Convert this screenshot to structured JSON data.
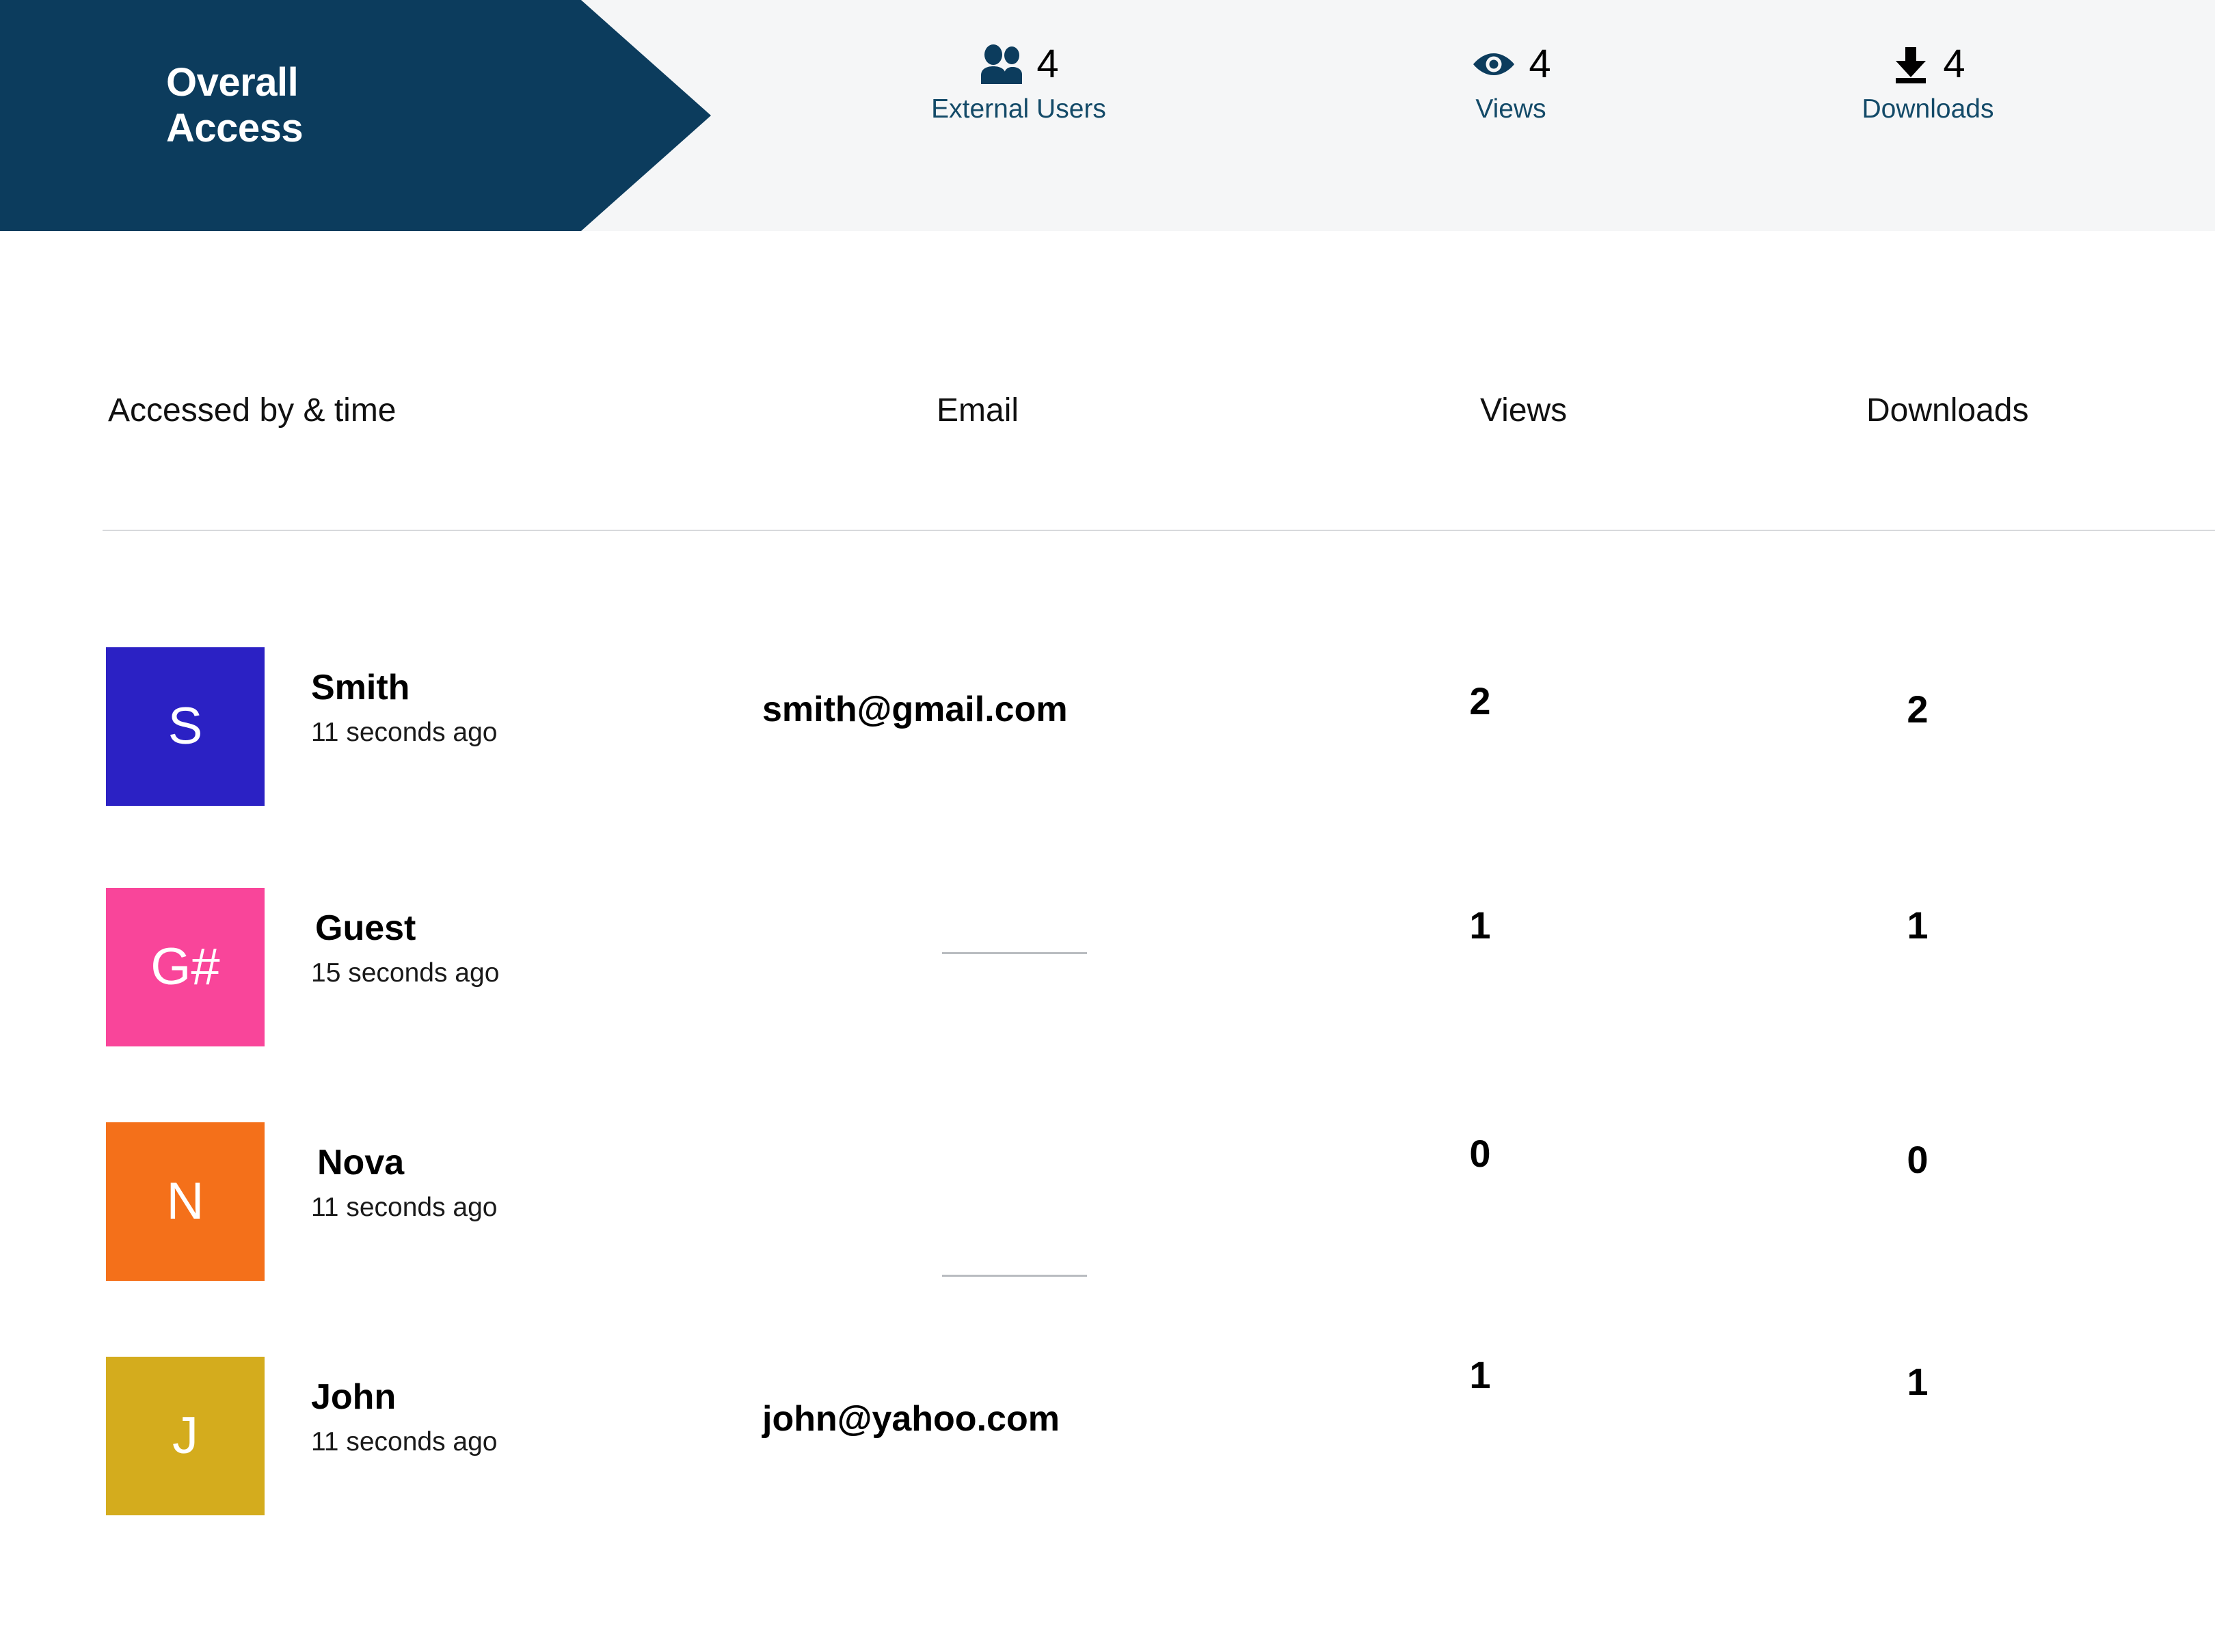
{
  "banner": {
    "title": "Overall\nAccess",
    "color": "#0c3c5d"
  },
  "summary_stats": [
    {
      "icon": "users-icon",
      "value": "4",
      "label": "External Users",
      "icon_color": "#0c3c5d",
      "label_color": "#134a68"
    },
    {
      "icon": "eye-icon",
      "value": "4",
      "label": "Views",
      "icon_color": "#0c3c5d",
      "label_color": "#134a68"
    },
    {
      "icon": "download-icon",
      "value": "4",
      "label": "Downloads",
      "icon_color": "#000000",
      "label_color": "#134a68"
    }
  ],
  "table": {
    "columns": {
      "accessed_by": "Accessed by & time",
      "email": "Email",
      "views": "Views",
      "downloads": "Downloads"
    },
    "rows": [
      {
        "initials": "S",
        "avatar_color": "#2b21c4",
        "name": "Smith",
        "time": "11 seconds ago",
        "email": "smith@gmail.com",
        "has_email": true,
        "views": "2",
        "downloads": "2"
      },
      {
        "initials": "G#",
        "avatar_color": "#f9459a",
        "name": "Guest",
        "time": "15 seconds ago",
        "email": "",
        "has_email": false,
        "views": "1",
        "downloads": "1"
      },
      {
        "initials": "N",
        "avatar_color": "#f4701a",
        "name": "Nova",
        "time": "11 seconds ago",
        "email": "",
        "has_email": false,
        "views": "0",
        "downloads": "0"
      },
      {
        "initials": "J",
        "avatar_color": "#d4ac1d",
        "name": "John",
        "time": "11 seconds ago",
        "email": "john@yahoo.com",
        "has_email": true,
        "views": "1",
        "downloads": "1"
      }
    ]
  }
}
